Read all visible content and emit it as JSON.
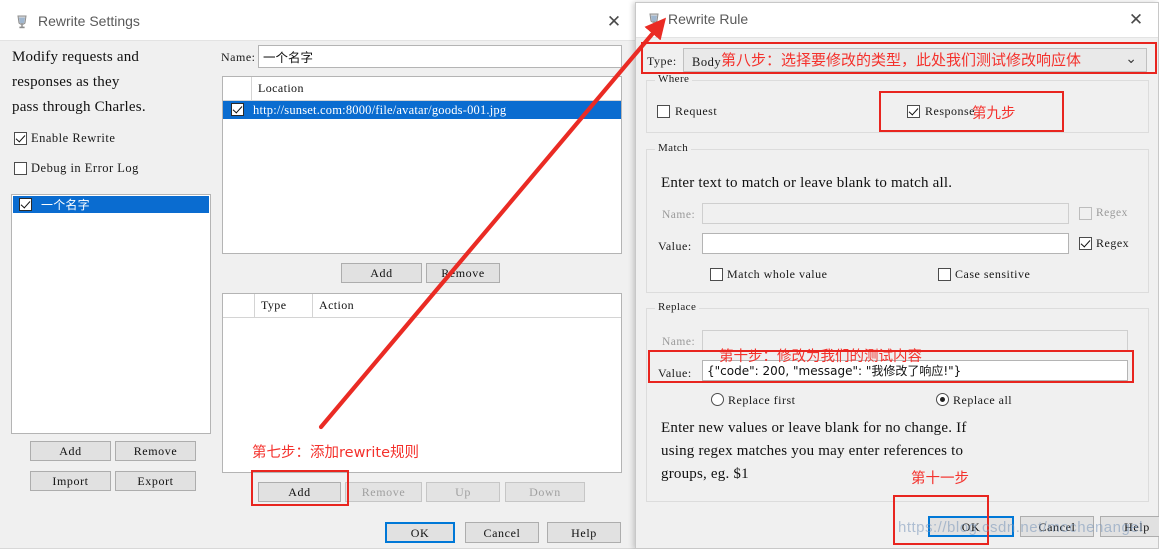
{
  "settings_window": {
    "title": "Rewrite Settings",
    "close_label": "✕",
    "description_lines": [
      "Modify requests and",
      "responses as they",
      "pass through Charles."
    ],
    "enable_rewrite_label": "Enable Rewrite",
    "enable_rewrite_checked": true,
    "debug_label": "Debug in Error Log",
    "debug_checked": false,
    "rule_sets": [
      {
        "label": "一个名字",
        "checked": true,
        "selected": true
      }
    ],
    "ruleset_buttons": [
      "Add",
      "Remove",
      "Import",
      "Export"
    ],
    "name_label": "Name:",
    "name_value": "一个名字",
    "locations_table": {
      "columns": [
        "",
        "Location"
      ],
      "rows": [
        {
          "checked": true,
          "location": "http://sunset.com:8000/file/avatar/goods-001.jpg",
          "selected": true
        }
      ]
    },
    "location_buttons": [
      "Add",
      "Remove"
    ],
    "rules_table": {
      "columns": [
        "",
        "Type",
        "Action"
      ],
      "rows": []
    },
    "rule_buttons": [
      {
        "label": "Add",
        "enabled": true
      },
      {
        "label": "Remove",
        "enabled": false
      },
      {
        "label": "Up",
        "enabled": false
      },
      {
        "label": "Down",
        "enabled": false
      }
    ],
    "dialog_buttons": [
      {
        "label": "OK",
        "default": true
      },
      {
        "label": "Cancel",
        "default": false
      },
      {
        "label": "Help",
        "default": false
      }
    ]
  },
  "rule_window": {
    "title": "Rewrite Rule",
    "close_label": "✕",
    "type_label": "Type:",
    "type_value": "Body",
    "type_caret": "⌄",
    "where": {
      "group_title": "Where",
      "request_label": "Request",
      "request_checked": false,
      "response_label": "Response",
      "response_checked": true
    },
    "match": {
      "group_title": "Match",
      "hint": "Enter text to match or leave blank to match all.",
      "name_label": "Name:",
      "name_value": "",
      "name_regex_label": "Regex",
      "name_regex_checked": false,
      "name_regex_enabled": false,
      "value_label": "Value:",
      "value_value": "",
      "value_regex_label": "Regex",
      "value_regex_checked": true,
      "match_whole_label": "Match whole value",
      "match_whole_checked": false,
      "case_sensitive_label": "Case sensitive",
      "case_sensitive_checked": false
    },
    "replace": {
      "group_title": "Replace",
      "name_label": "Name:",
      "name_value": "",
      "value_label": "Value:",
      "value_value": "{\"code\": 200, \"message\": \"我修改了响应!\"}",
      "replace_first_label": "Replace first",
      "replace_all_label": "Replace all",
      "replace_mode": "all",
      "hint_lines": [
        "Enter new values or leave blank for no change. If",
        "using regex matches you may enter references to",
        "groups, eg. $1"
      ]
    },
    "dialog_buttons": [
      {
        "label": "OK",
        "default": true
      },
      {
        "label": "Cancel",
        "default": false
      },
      {
        "label": "Help",
        "default": false
      }
    ]
  },
  "annotations": {
    "step7": "第七步：添加rewrite规则",
    "step8": "第八步：选择要修改的类型，此处我们测试修改响应体",
    "step9": "第九步",
    "step10": "第十步：修改为我们的测试内容",
    "step11": "第十一步",
    "accent_color": "#e8251f"
  },
  "watermark": {
    "text": "https://blog.csdn.net/mochenangel"
  }
}
